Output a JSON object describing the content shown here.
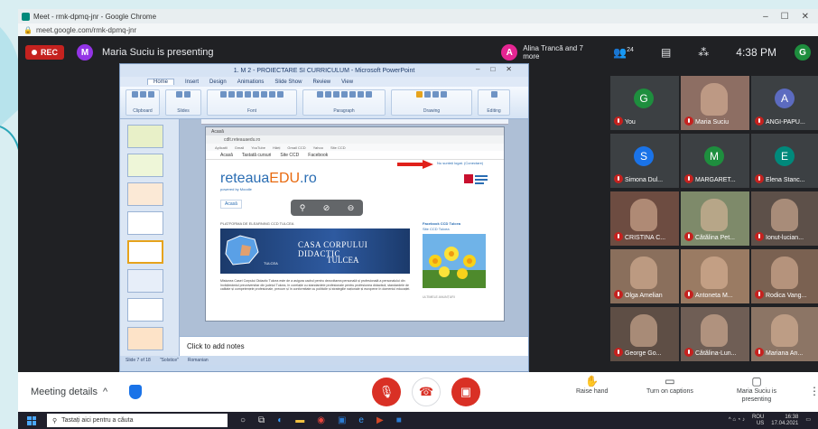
{
  "chrome": {
    "window_title": "Meet - rmk-dpmq-jnr - Google Chrome",
    "url": "meet.google.com/rmk-dpmq-jnr",
    "window_controls": [
      "–",
      "☐",
      "✕"
    ]
  },
  "meet": {
    "rec_label": "REC",
    "presenter_initial": "M",
    "presenter_text": "Maria Suciu is presenting",
    "others_initial": "A",
    "others_text": "Alina Trancă and 7 more",
    "participants_count": "24",
    "clock": "4:38 PM",
    "you_initial": "G",
    "you_label": "You"
  },
  "ppt": {
    "title": "1. M 2 - PROIECTARE SI CURRICULUM - Microsoft PowerPoint",
    "tabs": [
      "Home",
      "Insert",
      "Design",
      "Animations",
      "Slide Show",
      "Review",
      "View"
    ],
    "ribbon_groups": [
      "Clipboard",
      "Slides",
      "Font",
      "Paragraph",
      "Drawing",
      "Editing"
    ],
    "notes_placeholder": "Click to add notes",
    "status": [
      "Slide 7 of 18",
      "\"Solstice\"",
      "Romanian"
    ],
    "slide": {
      "inner_tab": "Acasă",
      "inner_url": "cdlt.reteauaedu.ro",
      "bookmarks": [
        "Aplicatii",
        "Gmail",
        "YouTube",
        "Hărți",
        "Gmail CCD",
        "Yahoo",
        "Site CCD"
      ],
      "nav": [
        "Acasă",
        "Tastată cursuri",
        "Site CCD",
        "Facebook"
      ],
      "logo_main": "reteaua",
      "logo_accent": "EDU",
      "logo_suffix": ".ro",
      "logo_sub": "powered by Moodle",
      "arrow_target": "Nu sunteți logat. (Conectare)",
      "acasa": "Acasă",
      "platform_title": "PLATFORMA DE ELEARNING CCD TULCEA",
      "banner_line1": "CASA  CORPULUI  DIDACTIC",
      "banner_line2": "TULCEA",
      "banner_map_label": "TULCEA",
      "description": "Misiunea Casei Corpului Didactic Tulcea este de a asigura cadrul pentru dezvoltarea personală și profesională a personalului din învățământul preuniversitar din județul Tulcea, în corelație cu standardele profesionale pentru profesiunea didactică, standardele de calitate și competențele profesionale, precum și în conformitate cu politicile și strategiile naționale și europene în domeniul educației.",
      "fb_title": "Facebook CCD Tulcea",
      "fb_sub": "Site CCD Tulcea",
      "latest": "ULTIMELE ANUNȚURI"
    },
    "overlay_icons": [
      "pin-icon",
      "hide-icon",
      "remove-icon"
    ]
  },
  "participants": [
    {
      "initial": "G",
      "name": "You",
      "color": "#1e8e3e",
      "camera": false
    },
    {
      "initial": "",
      "name": "Maria Suciu",
      "color": "#8d6e63",
      "camera": true
    },
    {
      "initial": "A",
      "name": "ANGI-PAPU...",
      "color": "#5c6bc0",
      "camera": false
    },
    {
      "initial": "S",
      "name": "Simona Dul...",
      "color": "#1a73e8",
      "camera": false
    },
    {
      "initial": "M",
      "name": "MARGARET...",
      "color": "#1e8e3e",
      "camera": false
    },
    {
      "initial": "E",
      "name": "Elena Stanc...",
      "color": "#00897b",
      "camera": false
    },
    {
      "initial": "",
      "name": "CRISTINA C...",
      "color": "#6d4c41",
      "camera": true
    },
    {
      "initial": "",
      "name": "Cătălina Pet...",
      "color": "#7e8a6a",
      "camera": true
    },
    {
      "initial": "",
      "name": "Ionut-lucian...",
      "color": "#5d5049",
      "camera": true
    },
    {
      "initial": "",
      "name": "Olga Amelian",
      "color": "#8a6f5c",
      "camera": true
    },
    {
      "initial": "",
      "name": "Antoneta M...",
      "color": "#9a7b63",
      "camera": true
    },
    {
      "initial": "",
      "name": "Rodica Vang...",
      "color": "#7a6151",
      "camera": true
    },
    {
      "initial": "",
      "name": "George Go...",
      "color": "#5e4e45",
      "camera": true
    },
    {
      "initial": "",
      "name": "Cătălina-Lun...",
      "color": "#6f5e55",
      "camera": true
    },
    {
      "initial": "",
      "name": "Mariana An...",
      "color": "#8c7565",
      "camera": true
    }
  ],
  "controls": {
    "meeting_details": "Meeting details",
    "chevron": "^",
    "raise_hand": "Raise hand",
    "captions": "Turn on captions",
    "presenting": "Maria Suciu is presenting",
    "more": "⋮"
  },
  "taskbar": {
    "search_placeholder": "Tastați aici pentru a căuta",
    "tray_lang": "ROU",
    "tray_sub": "US",
    "tray_time": "16:38",
    "tray_date": "17.04.2021"
  },
  "colors": {
    "meet_bg": "#202124",
    "end_call": "#d93025",
    "accent": "#1a73e8"
  }
}
